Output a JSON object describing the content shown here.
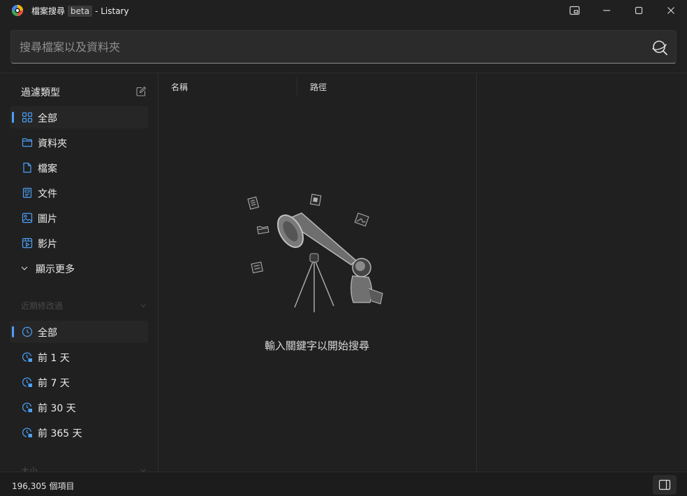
{
  "window": {
    "title_main": "檔案搜尋",
    "title_badge": "beta",
    "title_suffix": "- Listary"
  },
  "search": {
    "placeholder": "搜尋檔案以及資料夾",
    "value": ""
  },
  "sidebar": {
    "filter_heading": "過濾類型",
    "filter_items": [
      {
        "label": "全部",
        "icon": "grid-icon",
        "active": true
      },
      {
        "label": "資料夾",
        "icon": "folder-icon"
      },
      {
        "label": "檔案",
        "icon": "file-icon"
      },
      {
        "label": "文件",
        "icon": "document-icon"
      },
      {
        "label": "圖片",
        "icon": "image-icon"
      },
      {
        "label": "影片",
        "icon": "video-icon"
      }
    ],
    "show_more": "顯示更多",
    "recent_heading": "近期修改過",
    "time_items": [
      {
        "label": "全部",
        "icon": "clock-icon",
        "active": true
      },
      {
        "label": "前 1 天",
        "icon": "clock-1d-icon"
      },
      {
        "label": "前 7 天",
        "icon": "clock-7d-icon"
      },
      {
        "label": "前 30 天",
        "icon": "clock-1m-icon"
      },
      {
        "label": "前 365 天",
        "icon": "clock-1y-icon"
      }
    ],
    "size_heading": "大小"
  },
  "results": {
    "columns": [
      "名稱",
      "路徑"
    ],
    "empty_message": "輸入關鍵字以開始搜尋"
  },
  "status": {
    "count_text": "196,305 個項目"
  },
  "colors": {
    "accent": "#4ca0f5",
    "background": "#202020"
  }
}
